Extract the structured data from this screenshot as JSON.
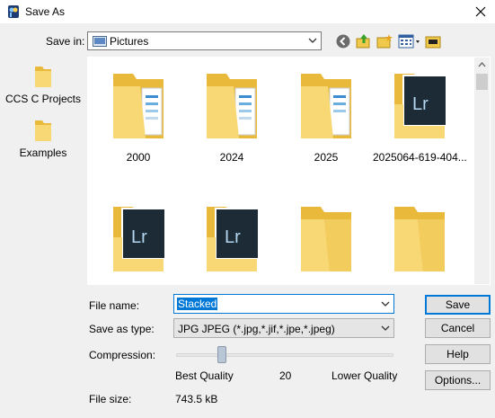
{
  "window": {
    "title": "Save As"
  },
  "toolbar": {
    "save_in_label": "Save in:",
    "save_in_value": "Pictures"
  },
  "places": [
    {
      "label": "CCS C Projects"
    },
    {
      "label": "Examples"
    }
  ],
  "files": [
    {
      "name": "2000",
      "kind": "folder"
    },
    {
      "name": "2024",
      "kind": "folder"
    },
    {
      "name": "2025",
      "kind": "folder"
    },
    {
      "name": "2025064-619-404...",
      "kind": "lightroom-folder"
    },
    {
      "name": "",
      "kind": "lightroom-folder"
    },
    {
      "name": "",
      "kind": "lightroom-folder"
    },
    {
      "name": "",
      "kind": "folder"
    },
    {
      "name": "",
      "kind": "folder"
    }
  ],
  "form": {
    "file_name_label": "File name:",
    "file_name_value": "Stacked",
    "save_as_type_label": "Save as type:",
    "save_as_type_value": "JPG JPEG  (*.jpg,*.jif,*.jpe,*.jpeg)",
    "compression_label": "Compression:",
    "compression_level": 20,
    "best_quality_label": "Best Quality",
    "compression_value_text": "20",
    "lower_quality_label": "Lower Quality",
    "file_size_label": "File size:",
    "file_size_value": "743.5 kB"
  },
  "buttons": {
    "save": "Save",
    "cancel": "Cancel",
    "help": "Help",
    "options": "Options..."
  },
  "colors": {
    "accent": "#0078d7",
    "folder": "#f8d775",
    "lightroom_bg": "#1c2b35",
    "lightroom_text": "#b3d7f0"
  }
}
